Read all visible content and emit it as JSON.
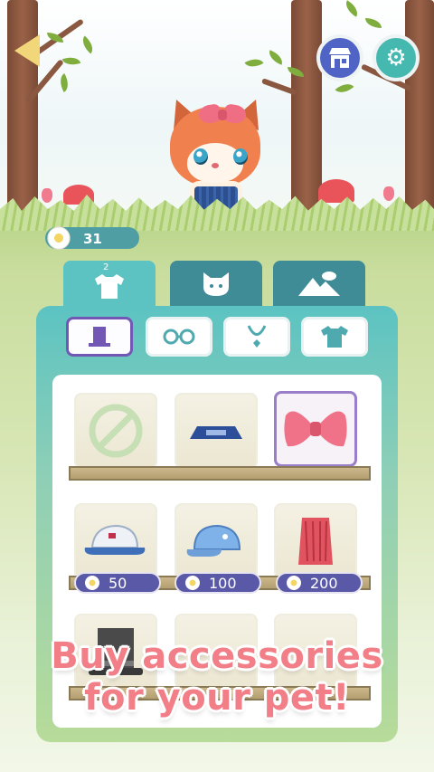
{
  "currency": {
    "amount": "31",
    "icon": "daisy-icon"
  },
  "top_bar": {
    "back_icon": "back-arrow-icon",
    "shop_icon": "shop-icon",
    "settings_icon": "gear-icon"
  },
  "category_tabs": [
    {
      "name": "clothes",
      "icon": "shirt-icon",
      "badge": "2",
      "active": true
    },
    {
      "name": "pet",
      "icon": "cat-face-icon",
      "active": false
    },
    {
      "name": "scene",
      "icon": "landscape-icon",
      "active": false
    }
  ],
  "sub_tabs": [
    {
      "name": "hats",
      "icon": "top-hat-icon",
      "active": true
    },
    {
      "name": "glasses",
      "icon": "glasses-icon",
      "active": false
    },
    {
      "name": "necklaces",
      "icon": "necklace-icon",
      "active": false
    },
    {
      "name": "shirts",
      "icon": "tshirt-icon",
      "active": false
    }
  ],
  "items": [
    {
      "name": "none",
      "icon": "no-item-icon",
      "price": null
    },
    {
      "name": "headband",
      "icon": "headband-icon",
      "price": null
    },
    {
      "name": "pink-bow",
      "icon": "bow-icon",
      "price": null,
      "selected": true
    },
    {
      "name": "white-cap",
      "icon": "white-cap-icon",
      "price": "50"
    },
    {
      "name": "blue-cap",
      "icon": "blue-cap-icon",
      "price": "100"
    },
    {
      "name": "red-crest",
      "icon": "crest-icon",
      "price": "200"
    },
    {
      "name": "top-hat",
      "icon": "top-hat-icon",
      "price": null
    }
  ],
  "promo": {
    "line1": "Buy accessories",
    "line2": "for your pet!"
  },
  "colors": {
    "teal": "#5cc3c2",
    "dark_teal": "#3f8c96",
    "purple": "#5a59a8",
    "promo_pink": "#f27f88"
  }
}
